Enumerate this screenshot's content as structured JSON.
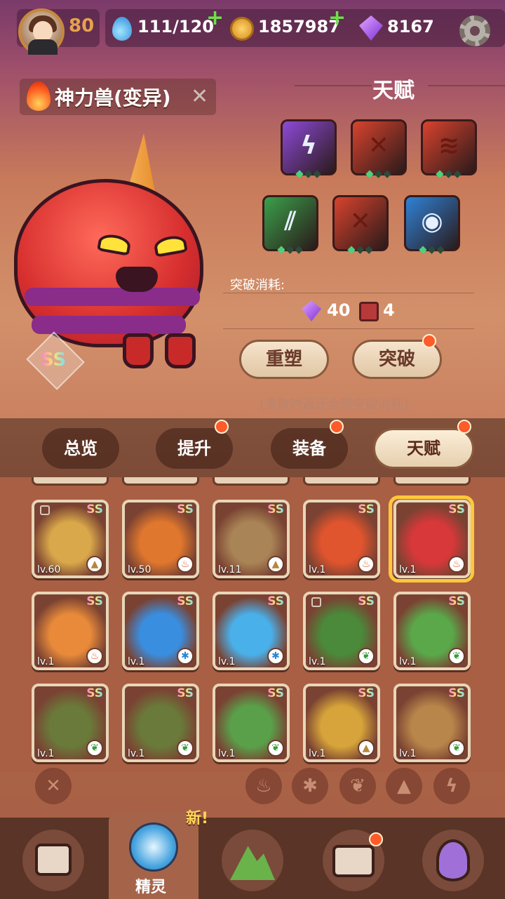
{
  "hud": {
    "level": "80",
    "stamina": "111/120",
    "gold": "1857987",
    "gems": "8167",
    "icons": [
      "avatar",
      "water-drop-icon",
      "coin-icon",
      "gem-icon",
      "gear-icon"
    ]
  },
  "pet": {
    "name": "神力兽(变异)",
    "rarity": "SS",
    "element_icon": "fire-icon"
  },
  "talent": {
    "title": "天赋",
    "skills": [
      {
        "icon": "lightning-icon",
        "glyph": "ϟ",
        "color": "#8e4ad8"
      },
      {
        "icon": "cross-claw-icon",
        "glyph": "✕",
        "color": "#d8432e"
      },
      {
        "icon": "triple-slash-icon",
        "glyph": "≋",
        "color": "#d8432e"
      },
      {
        "icon": "leaf-slash-icon",
        "glyph": "⫽",
        "color": "#3aa04a"
      },
      {
        "icon": "cross-claw-icon",
        "glyph": "✕",
        "color": "#d8432e"
      },
      {
        "icon": "eye-icon",
        "glyph": "◉",
        "color": "#2f82d6"
      }
    ],
    "cost_label": "突破消耗:",
    "cost_gems": "40",
    "cost_books": "4",
    "reshape_label": "重塑",
    "breakthrough_label": "突破",
    "note": "(遣散时返还全部突破消耗)"
  },
  "tabs": [
    "总览",
    "提升",
    "装备",
    "天赋"
  ],
  "cards": [
    {
      "lv": "lv.60",
      "el": "mountain",
      "color": "#d9a84a",
      "locked": true
    },
    {
      "lv": "lv.50",
      "el": "fire",
      "color": "#e0772e",
      "locked": false
    },
    {
      "lv": "lv.11",
      "el": "mountain",
      "color": "#a98456",
      "locked": false
    },
    {
      "lv": "lv.1",
      "el": "fire",
      "color": "#e0542e",
      "locked": false
    },
    {
      "lv": "lv.1",
      "el": "fire",
      "color": "#d8383a",
      "locked": false
    },
    {
      "lv": "lv.1",
      "el": "fire",
      "color": "#e88a3a",
      "locked": false
    },
    {
      "lv": "lv.1",
      "el": "ice",
      "color": "#3a8ee0",
      "locked": false
    },
    {
      "lv": "lv.1",
      "el": "ice",
      "color": "#4ab0ea",
      "locked": false
    },
    {
      "lv": "lv.1",
      "el": "leaf",
      "color": "#4a8a3a",
      "locked": true
    },
    {
      "lv": "lv.1",
      "el": "leaf",
      "color": "#5aa84a",
      "locked": false
    },
    {
      "lv": "lv.1",
      "el": "leaf",
      "color": "#6a7a3a",
      "locked": false
    },
    {
      "lv": "lv.1",
      "el": "leaf",
      "color": "#6a7a3a",
      "locked": false
    },
    {
      "lv": "lv.1",
      "el": "leaf",
      "color": "#5aa04a",
      "locked": false
    },
    {
      "lv": "lv.1",
      "el": "mountain",
      "color": "#d6a43a",
      "locked": false
    },
    {
      "lv": "lv.1",
      "el": "leaf",
      "color": "#b8864a",
      "locked": false
    }
  ],
  "filters": [
    "close-filter-icon",
    "fire-filter-icon",
    "ice-filter-icon",
    "leaf-filter-icon",
    "mountain-filter-icon",
    "lightning-filter-icon"
  ],
  "bottom_nav": {
    "active_label": "精灵",
    "new_label": "新!"
  },
  "colors": {
    "accent": "#ffc83a",
    "badge": "#ff5a2a"
  }
}
